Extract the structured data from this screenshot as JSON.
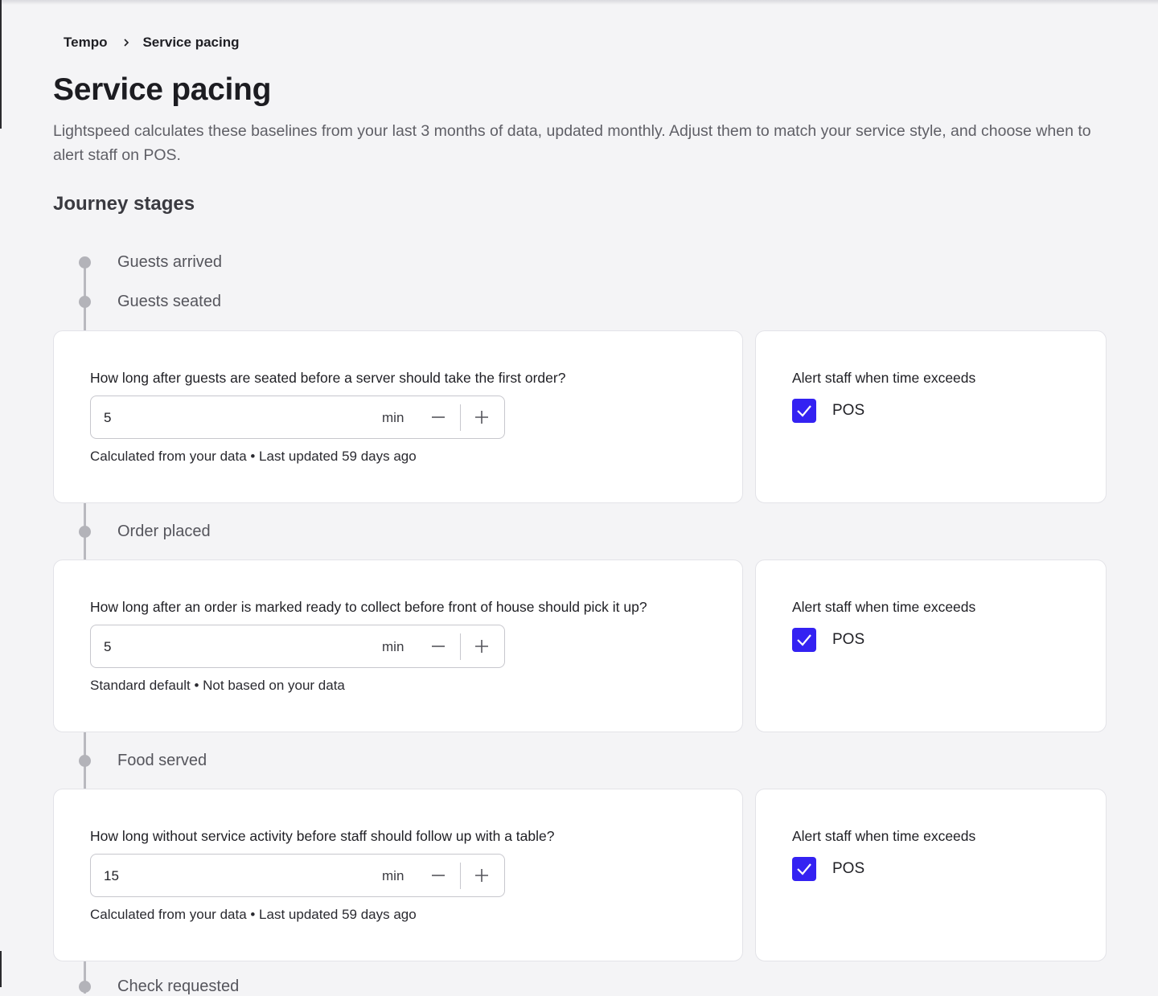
{
  "breadcrumb": {
    "root": "Tempo",
    "current": "Service pacing"
  },
  "page": {
    "title": "Service pacing",
    "description": "Lightspeed calculates these baselines from your last 3 months of data, updated monthly. Adjust them to match your service style, and choose when to alert staff on POS."
  },
  "section": {
    "title": "Journey stages"
  },
  "stages": {
    "guests_arrived": "Guests arrived",
    "guests_seated": "Guests seated",
    "order_placed": "Order placed",
    "food_served": "Food served",
    "check_requested": "Check requested"
  },
  "cards": [
    {
      "question": "How long after guests are seated before a server should take the first order?",
      "value": "5",
      "unit": "min",
      "hint": "Calculated from your data • Last updated 59 days ago",
      "alert_label": "Alert staff when time exceeds",
      "channel": "POS",
      "checked": true
    },
    {
      "question": "How long after an order is marked ready to collect before front of house should pick it up?",
      "value": "5",
      "unit": "min",
      "hint": "Standard default • Not based on your data",
      "alert_label": "Alert staff when time exceeds",
      "channel": "POS",
      "checked": true
    },
    {
      "question": "How long without service activity before staff should follow up with a table?",
      "value": "15",
      "unit": "min",
      "hint": "Calculated from your data • Last updated 59 days ago",
      "alert_label": "Alert staff when time exceeds",
      "channel": "POS",
      "checked": true
    }
  ],
  "colors": {
    "accent": "#3422f2",
    "timeline": "#b9b9bf"
  },
  "icons": {
    "breadcrumb_separator": "chevron-right-icon",
    "decrement": "minus-icon",
    "increment": "plus-icon",
    "checkbox": "checkmark-icon"
  }
}
